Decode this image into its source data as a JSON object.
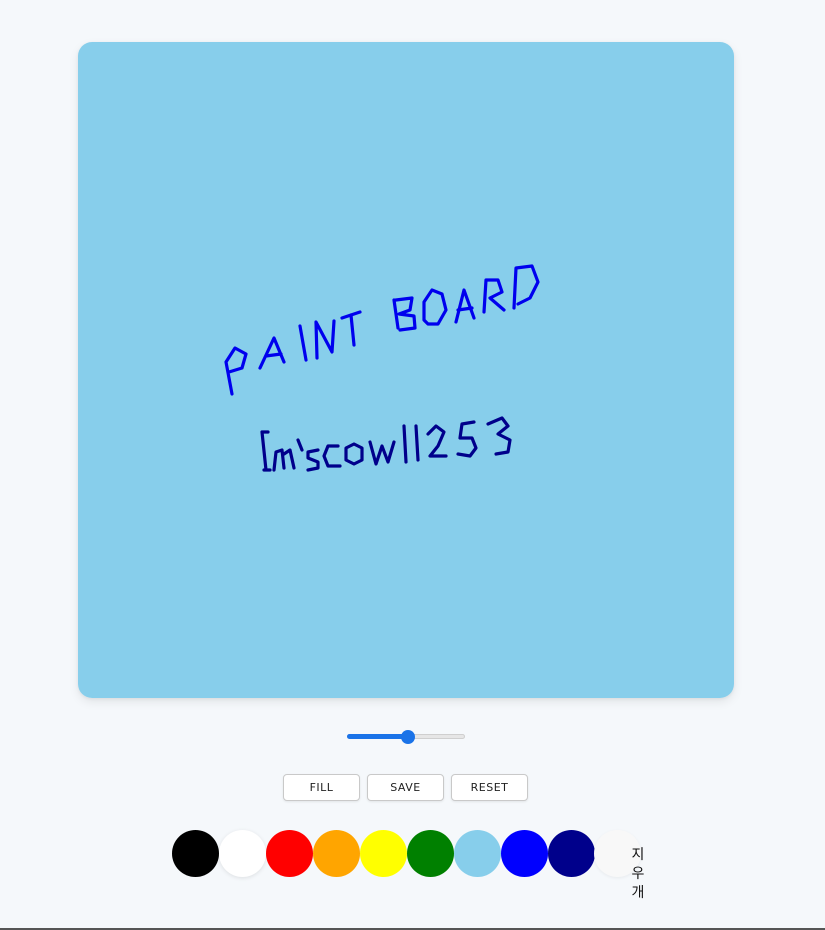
{
  "canvas": {
    "background_color": "#87ceeb",
    "drawn_text": [
      "PAINT BOARD",
      "Imscow11253"
    ]
  },
  "brush_size_slider": {
    "value_fraction": 0.52
  },
  "buttons": {
    "fill_label": "FILL",
    "save_label": "SAVE",
    "reset_label": "RESET"
  },
  "palette": {
    "colors": [
      "#000000",
      "#ffffff",
      "#ff0000",
      "#ffa500",
      "#ffff00",
      "#008000",
      "#87ceeb",
      "#0000ff",
      "#00008b"
    ],
    "eraser_label": "지우개"
  }
}
